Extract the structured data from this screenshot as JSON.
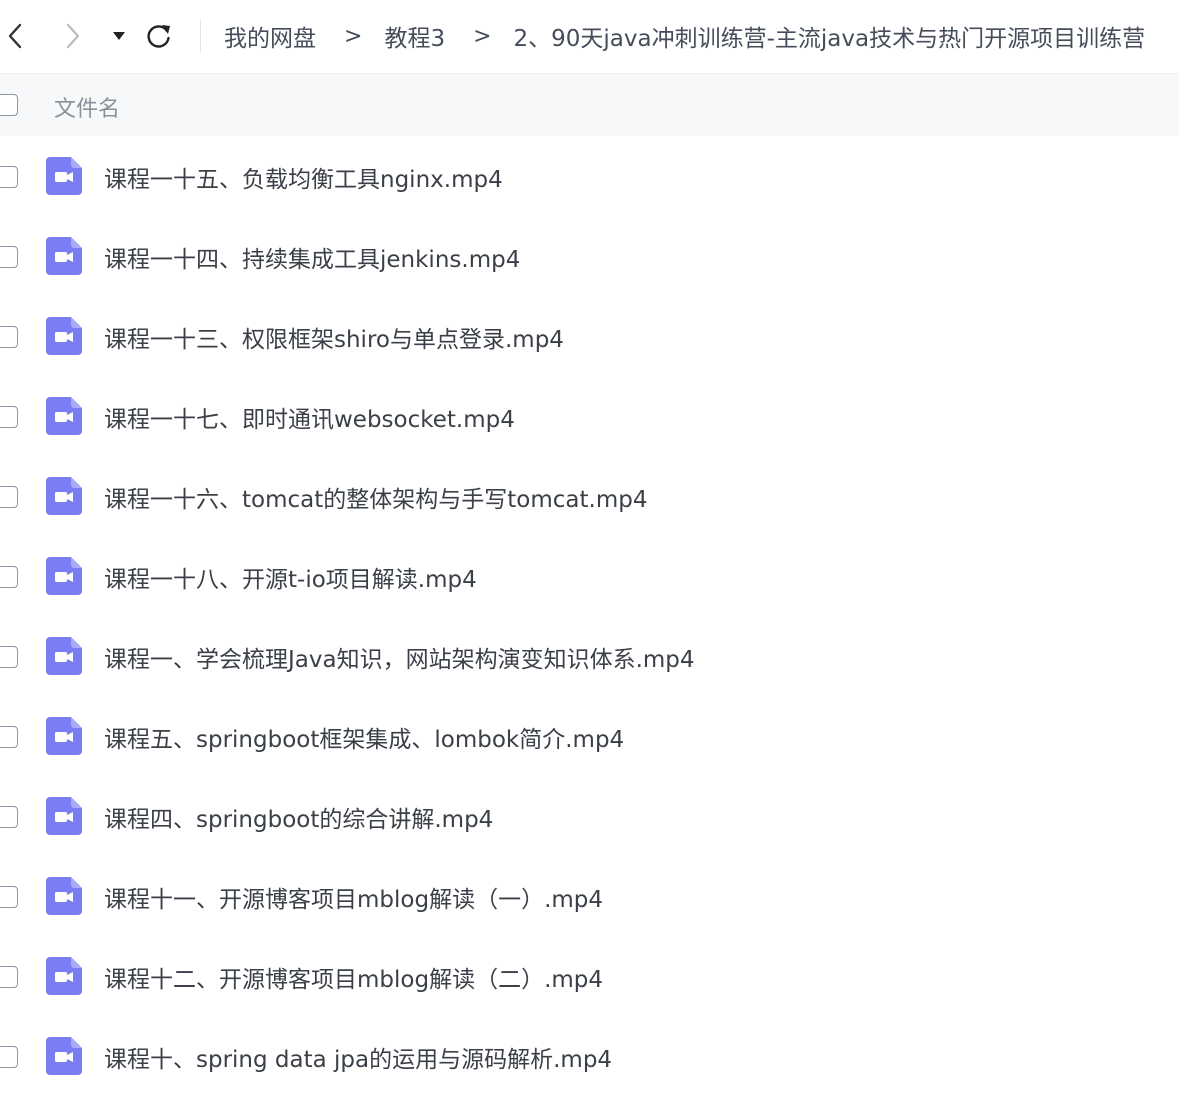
{
  "toolbar": {
    "back_icon": "chevron-left-icon",
    "forward_icon": "chevron-right-icon",
    "dropdown_icon": "caret-down-icon",
    "refresh_icon": "refresh-icon"
  },
  "breadcrumb": {
    "items": [
      "我的网盘",
      "教程3",
      "2、90天java冲刺训练营-主流java技术与热门开源项目训练营"
    ],
    "separator": ">"
  },
  "list_header": {
    "name_label": "文件名"
  },
  "colors": {
    "video_icon": "#7b7df2",
    "header_bg": "#f7f8fa"
  },
  "files": [
    {
      "name": "课程一十五、负载均衡工具nginx.mp4",
      "icon": "video-file-icon"
    },
    {
      "name": "课程一十四、持续集成工具jenkins.mp4",
      "icon": "video-file-icon"
    },
    {
      "name": "课程一十三、权限框架shiro与单点登录.mp4",
      "icon": "video-file-icon"
    },
    {
      "name": "课程一十七、即时通讯websocket.mp4",
      "icon": "video-file-icon"
    },
    {
      "name": "课程一十六、tomcat的整体架构与手写tomcat.mp4",
      "icon": "video-file-icon"
    },
    {
      "name": "课程一十八、开源t-io项目解读.mp4",
      "icon": "video-file-icon"
    },
    {
      "name": "课程一、学会梳理Java知识，网站架构演变知识体系.mp4",
      "icon": "video-file-icon"
    },
    {
      "name": "课程五、springboot框架集成、lombok简介.mp4",
      "icon": "video-file-icon"
    },
    {
      "name": "课程四、springboot的综合讲解.mp4",
      "icon": "video-file-icon"
    },
    {
      "name": "课程十一、开源博客项目mblog解读（一）.mp4",
      "icon": "video-file-icon"
    },
    {
      "name": "课程十二、开源博客项目mblog解读（二）.mp4",
      "icon": "video-file-icon"
    },
    {
      "name": "课程十、spring data jpa的运用与源码解析.mp4",
      "icon": "video-file-icon"
    }
  ]
}
